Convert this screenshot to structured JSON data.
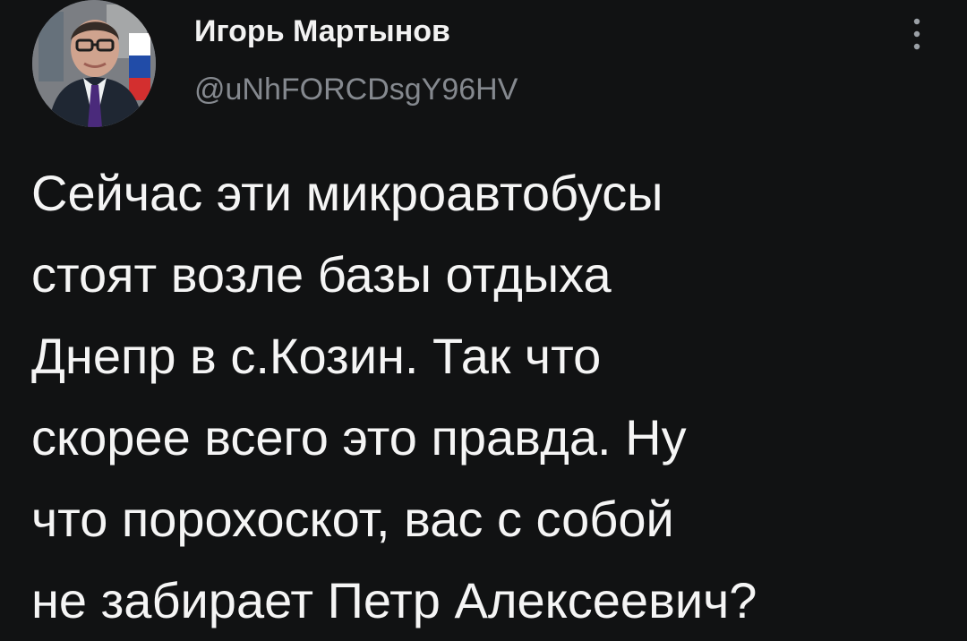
{
  "tweet": {
    "author": {
      "name": "Игорь Мартынов",
      "handle": "@uNhFORCDsgY96HV",
      "avatar_description": "profile photo of a man in a suit"
    },
    "more_icon": "vertical-ellipsis-icon",
    "text": "Сейчас эти микроавтобусы\nстоят возле базы отдыха\nДнепр в с.Козин. Так что\nскорее всего это правда. Ну\nчто порохоскот, вас с собой\nне забирает Петр Алексеевич?"
  },
  "colors": {
    "background": "#111213",
    "text": "#f5f5f5",
    "secondary_text": "#85898f"
  }
}
